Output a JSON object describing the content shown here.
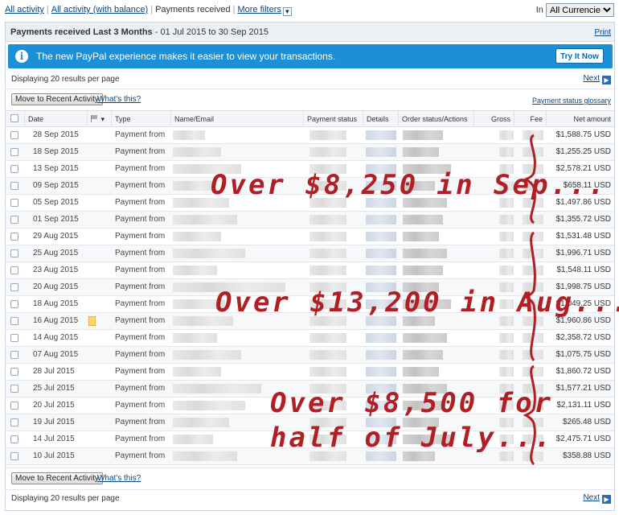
{
  "topbar": {
    "link_all_activity": "All activity",
    "link_all_activity_balance": "All activity (with balance)",
    "current_view": "Payments received",
    "link_more_filters": "More filters",
    "currency_label": "In",
    "currency_value": "All Currencies"
  },
  "panel": {
    "title_bold": "Payments received Last 3 Months",
    "title_range": " - 01 Jul 2015 to 30 Sep 2015",
    "print_label": "Print"
  },
  "banner": {
    "message": "The new PayPal experience makes it easier to view your transactions.",
    "button_label": "Try It Now",
    "icon": "info-icon",
    "color": "#1b90d6"
  },
  "results": {
    "top_text": "Displaying 20 results per page",
    "bottom_text": "Displaying 20 results per page",
    "next_label": "Next"
  },
  "actions": {
    "move_button": "Move to Recent Activity",
    "whats_this": "What's this?",
    "glossary": "Payment status glossary"
  },
  "table": {
    "headers": {
      "date": "Date",
      "type": "Type",
      "name": "Name/Email",
      "status": "Payment status",
      "details": "Details",
      "order": "Order status/Actions",
      "gross": "Gross",
      "fee": "Fee",
      "net": "Net amount"
    },
    "rows": [
      {
        "date": "28 Sep 2015",
        "type": "Payment from",
        "net": "$1,588.75 USD"
      },
      {
        "date": "18 Sep 2015",
        "type": "Payment from",
        "net": "$1,255.25 USD"
      },
      {
        "date": "13 Sep 2015",
        "type": "Payment from",
        "net": "$2,578.21 USD"
      },
      {
        "date": "09 Sep 2015",
        "type": "Payment from",
        "net": "$658.11 USD"
      },
      {
        "date": "05 Sep 2015",
        "type": "Payment from",
        "net": "$1,497.86 USD"
      },
      {
        "date": "01 Sep 2015",
        "type": "Payment from",
        "net": "$1,355.72 USD"
      },
      {
        "date": "29 Aug 2015",
        "type": "Payment from",
        "net": "$1,531.48 USD"
      },
      {
        "date": "25 Aug 2015",
        "type": "Payment from",
        "net": "$1,996.71 USD"
      },
      {
        "date": "23 Aug 2015",
        "type": "Payment from",
        "net": "$1,548.11 USD"
      },
      {
        "date": "20 Aug 2015",
        "type": "Payment from",
        "net": "$1,998.75 USD"
      },
      {
        "date": "18 Aug 2015",
        "type": "Payment from",
        "net": "$1,049.25 USD"
      },
      {
        "date": "16 Aug 2015",
        "type": "Payment from",
        "net": "$1,960.86 USD",
        "flag": true
      },
      {
        "date": "14 Aug 2015",
        "type": "Payment from",
        "net": "$2,358.72 USD"
      },
      {
        "date": "07 Aug 2015",
        "type": "Payment from",
        "net": "$1,075.75 USD"
      },
      {
        "date": "28 Jul 2015",
        "type": "Payment from",
        "net": "$1,860.72 USD"
      },
      {
        "date": "25 Jul 2015",
        "type": "Payment from",
        "net": "$1,577.21 USD"
      },
      {
        "date": "20 Jul 2015",
        "type": "Payment from",
        "net": "$2,131.11 USD"
      },
      {
        "date": "19 Jul 2015",
        "type": "Payment from",
        "net": "$265.48 USD"
      },
      {
        "date": "14 Jul 2015",
        "type": "Payment from",
        "net": "$2,475.71 USD"
      },
      {
        "date": "10 Jul 2015",
        "type": "Payment from",
        "net": "$358.88 USD"
      }
    ]
  },
  "annotations": {
    "sep": "Over $8,250 in Sep...",
    "aug": "Over $13,200 in Aug...",
    "jul_line1": "Over $8,500 for",
    "jul_line2": "half of July...",
    "color": "#b01f24"
  }
}
